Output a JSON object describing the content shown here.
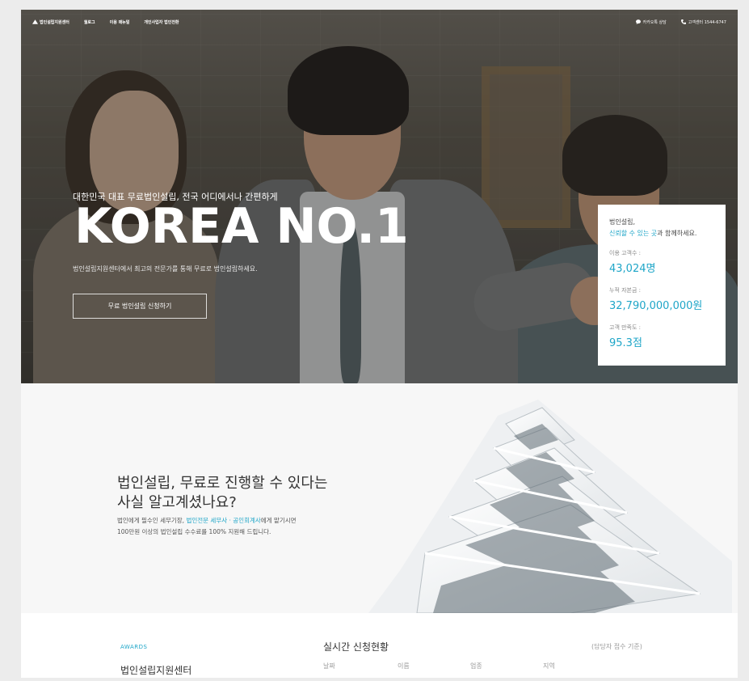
{
  "nav": {
    "logo": "법인설립지원센터",
    "links": [
      "월로그",
      "이용 매뉴얼",
      "개인사업자 법인전환"
    ],
    "kakao": "카카오톡 상담",
    "phone": "고객센터 1544-6747"
  },
  "hero": {
    "subtitle": "대한민국 대표 무료법인설립, 전국 어디에서나 간편하게",
    "title": "KOREA NO.1",
    "description": "법인설립지원센터에서 최고의 전문가를 통해 무료로 법인설립하세요.",
    "cta": "무료 법인설립 신청하기"
  },
  "stats": {
    "heading": "법인설립,",
    "tagline_accent": "신뢰할 수 있는 곳",
    "tagline_rest": "과 함께하세요.",
    "items": [
      {
        "label": "이용 고객수 :",
        "value": "43,024명"
      },
      {
        "label": "누적 자본금 :",
        "value": "32,790,000,000원"
      },
      {
        "label": "고객 만족도 :",
        "value": "95.3점"
      }
    ]
  },
  "section2": {
    "heading_line1": "법인설립, 무료로 진행할 수 있다는",
    "heading_line2": "사실 알고계셨나요?",
    "desc_pre": "법인에게 필수인 세무기장, ",
    "desc_accent": "법인전문 세무사 · 공인회계사",
    "desc_post": "에게 맡기시면",
    "desc_line2": "100만원 이상의 법인설립 수수료를 100% 지원해 드립니다."
  },
  "section3": {
    "awards_label": "AWARDS",
    "center_name": "법인설립지원센터",
    "realtime_title": "실시간 신청현황",
    "realtime_note": "(담당자 접수 기준)",
    "columns": [
      "날짜",
      "이름",
      "업종",
      "지역"
    ]
  },
  "colors": {
    "accent": "#1fa6c8",
    "hero_text": "#ffffff"
  }
}
